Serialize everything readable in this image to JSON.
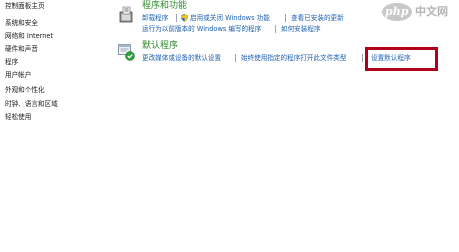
{
  "sidebar": {
    "items": [
      {
        "label": "控制面板主页"
      },
      {
        "label": "系统和安全"
      },
      {
        "label": "网络和 Internet"
      },
      {
        "label": "硬件和声音"
      },
      {
        "label": "程序"
      },
      {
        "label": "用户帐户"
      },
      {
        "label": "外观和个性化"
      },
      {
        "label": "时钟、语言和区域"
      },
      {
        "label": "轻松使用"
      }
    ]
  },
  "programs": {
    "title": "程序和功能",
    "icon": "programs-features-icon",
    "links": {
      "uninstall": "卸载程序",
      "windows_features": "启用或关闭 Windows 功能",
      "installed_updates": "查看已安装的更新",
      "compat": "运行为以前版本的 Windows 编写的程序",
      "how_to_install": "如何安装程序"
    }
  },
  "defaults": {
    "title": "默认程序",
    "icon": "default-programs-icon",
    "links": {
      "media_autoplay": "更改媒体或设备的默认设置",
      "open_with": "始终使用指定的程序打开此文件类型",
      "set_defaults": "设置默认程序"
    }
  },
  "highlight": {
    "color": "#b0001b"
  },
  "watermark": {
    "logo": "php",
    "text": "中文网"
  },
  "colors": {
    "title_green": "#2f8a2f",
    "link_blue": "#1b5fae",
    "highlight_red": "#b0001b"
  }
}
